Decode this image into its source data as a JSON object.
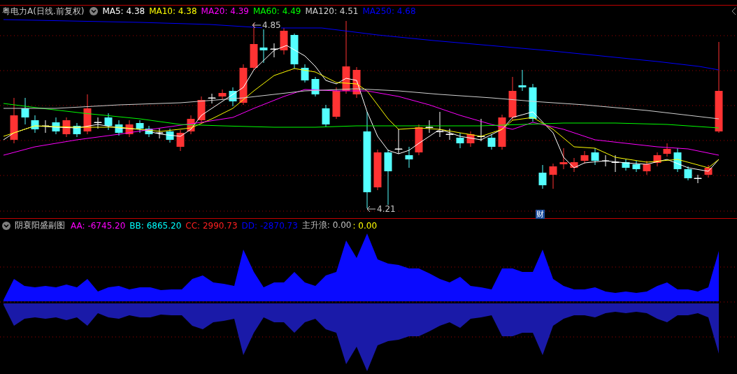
{
  "header": {
    "title": "粤电力A(日线.前复权)",
    "moving_averages": [
      {
        "label": "MA5: 4.38",
        "color": "#ffffff"
      },
      {
        "label": "MA10: 4.38",
        "color": "#ffff00"
      },
      {
        "label": "MA20: 4.39",
        "color": "#ff00ff"
      },
      {
        "label": "MA60: 4.49",
        "color": "#00ff00"
      },
      {
        "label": "MA120: 4.51",
        "color": "#d0d0d0"
      },
      {
        "label": "MA250: 4.68",
        "color": "#0000ff"
      }
    ]
  },
  "price_chart": {
    "high_label": "4.85",
    "low_label": "4.21",
    "badge": "财"
  },
  "indicator": {
    "title": "阴衰阳盛副图",
    "values": [
      {
        "label": "AA: -6745.20",
        "color": "#ff00ff"
      },
      {
        "label": "BB: 6865.20",
        "color": "#00ffff"
      },
      {
        "label": "CC: 2990.73",
        "color": "#ff2020"
      },
      {
        "label": "DD: -2870.73",
        "color": "#0000ff"
      },
      {
        "label": "主升浪: 0.00",
        "color": "#c0c0c0"
      },
      {
        "label": ": 0.00",
        "color": "#ffff00"
      }
    ]
  }
}
